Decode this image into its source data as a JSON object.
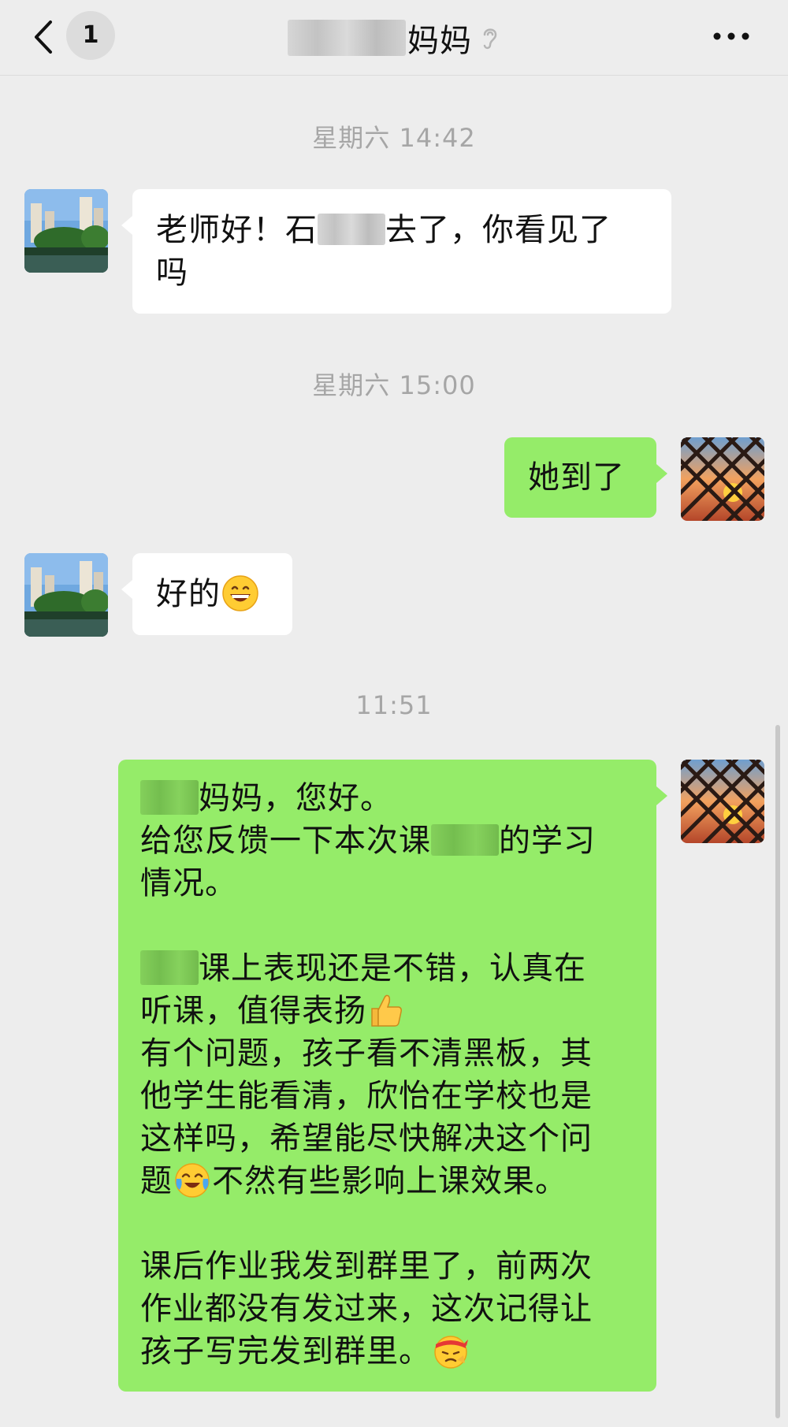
{
  "header": {
    "back_icon": "chevron-left-icon",
    "unread_count": "1",
    "title": "妈妈",
    "mute_icon": "ear-mute-icon",
    "more_icon": "more-dots-icon"
  },
  "messages": {
    "t1": "星期六 14:42",
    "m1_line1_a": "老师好！石",
    "m1_line1_b": "去了，你看见了",
    "m1_line2": "吗",
    "t2": "星期六 15:00",
    "m2": "她到了",
    "m3": "好的",
    "t3": "11:51",
    "m4": {
      "l1": "妈妈，您好。",
      "l2_a": "给您反馈一下本次课",
      "l2_b": "的学习",
      "l3": "情况。",
      "l4": "课上表现还是不错，认真在",
      "l5": "听课，值得表扬",
      "l6": "有个问题，孩子看不清黑板，其",
      "l7": "他学生能看清，欣怡在学校也是",
      "l8": "这样吗，希望能尽快解决这个问",
      "l9_a": "题",
      "l9_b": "不然有些影响上课效果。",
      "l10": "课后作业我发到群里了，前两次",
      "l11": "作业都没有发过来，这次记得让",
      "l12": "孩子写完发到群里。"
    }
  },
  "emojis": {
    "grin": "grinning-emoji",
    "thumbs_up": "thumbs-up-emoji",
    "crying": "crying-laughing-emoji",
    "determined": "headband-emoji"
  },
  "colors": {
    "background": "#ededed",
    "incoming_bubble": "#ffffff",
    "outgoing_bubble": "#95ec69",
    "timestamp": "#a6a6a6"
  }
}
